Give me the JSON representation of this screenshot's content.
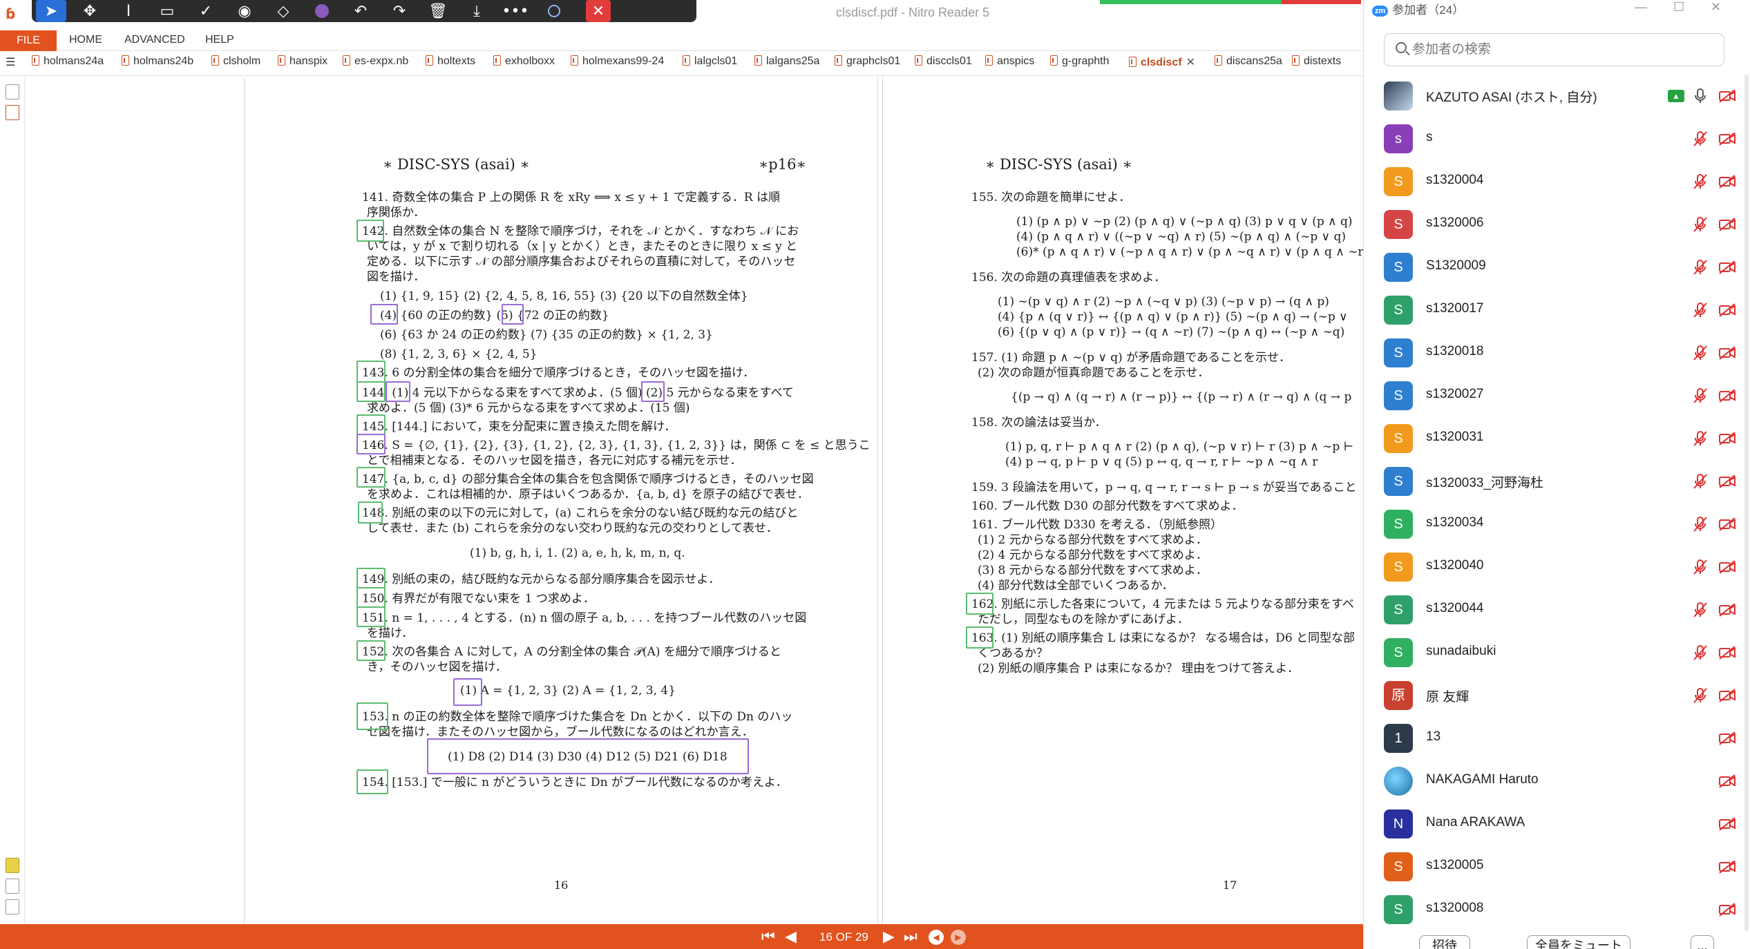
{
  "window": {
    "title": "clsdiscf.pdf - Nitro Reader 5"
  },
  "toolbar": {
    "icons": [
      "select-arrow",
      "pan",
      "text-cursor",
      "rectangle",
      "checkmark",
      "stamp",
      "eraser",
      "color-swatch",
      "undo",
      "redo",
      "delete",
      "download",
      "more",
      "user-color",
      "close"
    ]
  },
  "ribbon": {
    "file": "FILE",
    "home": "HOME",
    "advanced": "ADVANCED",
    "help": "HELP"
  },
  "doc_tabs": [
    "holmans24a",
    "holmans24b",
    "clsholm",
    "hanspix",
    "es-expx.nb",
    "holtexts",
    "exholboxx",
    "holmexans99-24",
    "lalgcls01",
    "lalgans25a",
    "graphcls01",
    "disccls01",
    "anspics",
    "g-graphth",
    "clsdiscf",
    "discans25a",
    "distexts"
  ],
  "active_tab": "clsdiscf",
  "page16": {
    "header_left": "∗ DISC-SYS (asai) ∗",
    "header_right": "∗p16∗",
    "lines": [
      "141. 奇数全体の集合 P 上の関係 R を xRy ⟺ x ≤ y + 1 で定義する．R は順",
      "序関係か．",
      "142. 自然数全体の集合 N を整除で順序づけ，それを 𝒩 とかく．すなわち 𝒩 にお",
      "いては，y が x で割り切れる（x | y とかく）とき，またそのときに限り x ≤ y と",
      "定める．以下に示す 𝒩 の部分順序集合およびそれらの直積に対して，そのハッセ",
      "図を描け．",
      "(1) {1, 9, 15}    (2) {2, 4, 5, 8, 16, 55}    (3) {20 以下の自然数全体}",
      "(4) {60 の正の約数}    (5) {72 の正の約数}",
      "(6) {63 か 24 の正の約数}    (7) {35 の正の約数} × {1, 2, 3}",
      "(8) {1, 2, 3, 6} × {2, 4, 5}",
      "143. 6 の分割全体の集合を細分で順序づけるとき，そのハッセ図を描け．",
      "144. (1) 4 元以下からなる束をすべて求めよ．(5 個)  (2) 5 元からなる束をすべて",
      "求めよ．(5 個) (3)* 6 元からなる束をすべて求めよ．(15 個)",
      "145. [144.] において，束を分配束に置き換えた問を解け．",
      "146. S = {∅, {1}, {2}, {3}, {1, 2}, {2, 3}, {1, 3}, {1, 2, 3}} は，関係 ⊂ を ≤ と思うこ",
      "とで相補束となる．そのハッセ図を描き，各元に対応する補元を示せ．",
      "147. {a, b, c, d} の部分集合全体の集合を包含関係で順序づけるとき，そのハッセ図",
      "を求めよ．これは相補的か．原子はいくつあるか．{a, b, d} を原子の結びで表せ．",
      "148. 別紙の束の以下の元に対して，(a) これらを余分のない結び既約な元の結びと",
      "して表せ．また (b) これらを余分のない交わり既約な元の交わりとして表せ．",
      "(1) b, g, h, i, 1.          (2) a, e, h, k, m, n, q.",
      "149. 別紙の束の，結び既約な元からなる部分順序集合を図示せよ．",
      "150. 有界だが有限でない束を 1 つ求めよ．",
      "151. n = 1, . . . , 4 とする．(n)  n 個の原子 a, b, . . . を持つブール代数のハッセ図",
      "を描け．",
      "152. 次の各集合 A に対して，A の分割全体の集合 𝒫(A) を細分で順序づけると",
      "き，そのハッセ図を描け．",
      "(1) A = {1, 2, 3}              (2) A = {1, 2, 3, 4}",
      "153. n の正の約数全体を整除で順序づけた集合を Dn とかく．以下の Dn のハッ",
      "セ図を描け．またそのハッセ図から，ブール代数になるのはどれか言え．",
      "(1) D8    (2) D14    (3) D30    (4) D12    (5) D21    (6) D18",
      "154. [153.] で一般に n がどういうときに Dn がブール代数になるのか考えよ．"
    ],
    "page_number": "16"
  },
  "page17": {
    "header_left": "∗ DISC-SYS (asai) ∗",
    "lines": [
      "155. 次の命題を簡単にせよ．",
      "(1) (p ∧ p) ∨ ∼p    (2) (p ∧ q) ∨ (∼p ∧ q)    (3) p ∨ q ∨ (p ∧ q)",
      "(4) (p ∧ q ∧ r) ∨ ((∼p ∨ ∼q) ∧ r)    (5) ∼(p ∧ q) ∧ (∼p ∨ q)",
      "(6)* (p ∧ q ∧ r) ∨ (∼p ∧ q ∧ r) ∨ (p ∧ ∼q ∧ r) ∨ (p ∧ q ∧ ∼r)",
      "156. 次の命題の真理値表を求めよ．",
      "(1) ∼(p ∨ q) ∧ r    (2) ∼p ∧ (∼q ∨ p)    (3) (∼p ∨ p) → (q ∧ p)",
      "(4) {p ∧ (q ∨ r)} ↔ {(p ∧ q) ∨ (p ∧ r)}    (5) ∼(p ∧ q) → (∼p ∨",
      "(6) {(p ∨ q) ∧ (p ∨ r)} → (q ∧ ∼r)    (7) ∼(p ∧ q) ↔ (∼p ∧ ∼q)",
      "157. (1) 命題 p ∧ ∼(p ∨ q) が矛盾命題であることを示せ．",
      "(2) 次の命題が恒真命題であることを示せ．",
      "{(p → q) ∧ (q → r) ∧ (r → p)} ↔ {(p → r) ∧ (r → q) ∧ (q → p",
      "158. 次の論法は妥当か．",
      "(1) p, q, r ⊢ p ∧ q ∧ r    (2) (p ∧ q), (∼p ∨ r) ⊢ r    (3) p ∧ ∼p ⊢",
      "(4) p → q, p ⊢ p ∨ q        (5) p ↔ q, q → r, r ⊢ ∼p ∧ ∼q ∧ r",
      "159. 3 段論法を用いて，p → q, q → r, r → s ⊢ p → s が妥当であること",
      "160. ブール代数 D30 の部分代数をすべて求めよ．",
      "161. ブール代数 D330 を考える．（別紙参照）",
      "(1) 2 元からなる部分代数をすべて求めよ．",
      "(2) 4 元からなる部分代数をすべて求めよ．",
      "(3) 8 元からなる部分代数をすべて求めよ．",
      "(4) 部分代数は全部でいくつあるか．",
      "162. 別紙に示した各束について，4 元または 5 元よりなる部分束をすべ",
      "ただし，同型なものを除かずにあげよ．",
      "163. (1) 別紙の順序集合 L は束になるか？ なる場合は，D6 と同型な部",
      "くつあるか？",
      "(2) 別紙の順序集合 P は束になるか？ 理由をつけて答えよ．"
    ],
    "page_number": "17"
  },
  "status": {
    "page_indicator": "16 OF 29"
  },
  "zoom": {
    "title": "参加者（24）",
    "search_placeholder": "参加者の検索",
    "participants": [
      {
        "initial": "",
        "name": "KAZUTO ASAI (ホスト, 自分)",
        "color": "#6b8fb8"
      },
      {
        "initial": "s",
        "name": "s",
        "color": "#8a3fb8"
      },
      {
        "initial": "S",
        "name": "s1320004",
        "color": "#f29a1d"
      },
      {
        "initial": "S",
        "name": "s1320006",
        "color": "#d64545"
      },
      {
        "initial": "S",
        "name": "S1320009",
        "color": "#2f7fd1"
      },
      {
        "initial": "S",
        "name": "s1320017",
        "color": "#2fa06a"
      },
      {
        "initial": "S",
        "name": "s1320018",
        "color": "#2f7fd1"
      },
      {
        "initial": "S",
        "name": "s1320027",
        "color": "#2f7fd1"
      },
      {
        "initial": "S",
        "name": "s1320031",
        "color": "#f29a1d"
      },
      {
        "initial": "S",
        "name": "s1320033_河野海杜",
        "color": "#2f7fd1"
      },
      {
        "initial": "S",
        "name": "s1320034",
        "color": "#2fb060"
      },
      {
        "initial": "S",
        "name": "s1320040",
        "color": "#f29a1d"
      },
      {
        "initial": "S",
        "name": "s1320044",
        "color": "#2fa06a"
      },
      {
        "initial": "S",
        "name": "sunadaibuki",
        "color": "#2fb060"
      },
      {
        "initial": "原",
        "name": "原 友輝",
        "color": "#c9412f"
      },
      {
        "initial": "1",
        "name": "13",
        "color": "#2d3a4a"
      },
      {
        "initial": "",
        "name": "NAKAGAMI Haruto",
        "color": "#3a9bd1"
      },
      {
        "initial": "N",
        "name": "Nana ARAKAWA",
        "color": "#2a2f9e"
      },
      {
        "initial": "S",
        "name": "s1320005",
        "color": "#e0601a"
      },
      {
        "initial": "S",
        "name": "s1320008",
        "color": "#2fa06a"
      }
    ],
    "invite": "招待",
    "mute_all": "全員をミュート",
    "more": "..."
  }
}
